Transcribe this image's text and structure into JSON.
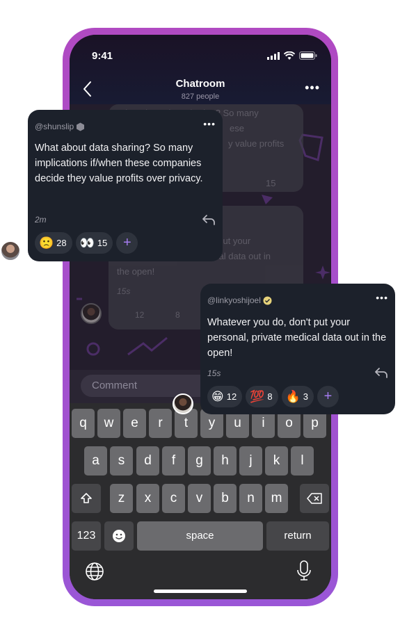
{
  "status": {
    "time": "9:41"
  },
  "header": {
    "title": "Chatroom",
    "subtitle": "827 people"
  },
  "background_chat": {
    "message_1_lines": [
      "What about data sharing? So many",
      "ese",
      "y value profits"
    ],
    "message_1_count": "15",
    "message_2_lines": [
      "t put your",
      "cal data out in",
      "the open!"
    ],
    "message_2_time": "15s",
    "message_2_reactions": [
      "12",
      "8"
    ]
  },
  "comment": {
    "placeholder": "Comment"
  },
  "keyboard": {
    "row1": [
      "q",
      "w",
      "e",
      "r",
      "t",
      "y",
      "u",
      "i",
      "o",
      "p"
    ],
    "row2": [
      "a",
      "s",
      "d",
      "f",
      "g",
      "h",
      "j",
      "k",
      "l"
    ],
    "row3": [
      "z",
      "x",
      "c",
      "v",
      "b",
      "n",
      "m"
    ],
    "numbers_label": "123",
    "space_label": "space",
    "return_label": "return"
  },
  "bubble_1": {
    "handle": "@shunslip",
    "message": "What about data sharing? So many implications if/when these companies decide they value profits over privacy.",
    "time": "2m",
    "reactions": [
      {
        "emoji": "🙁",
        "count": "28"
      },
      {
        "emoji": "👀",
        "count": "15"
      }
    ],
    "add_label": "+"
  },
  "bubble_2": {
    "handle": "@linkyoshijoel",
    "message": "Whatever you do, don't put your personal, private medical data out in the open!",
    "time": "15s",
    "reactions": [
      {
        "emoji": "😁",
        "count": "12"
      },
      {
        "emoji": "💯",
        "count": "8"
      },
      {
        "emoji": "🔥",
        "count": "3"
      }
    ],
    "add_label": "+"
  },
  "colors": {
    "accent": "#a57cf0",
    "phone_frame": "#a650cc",
    "bubble": "#1c212b"
  }
}
